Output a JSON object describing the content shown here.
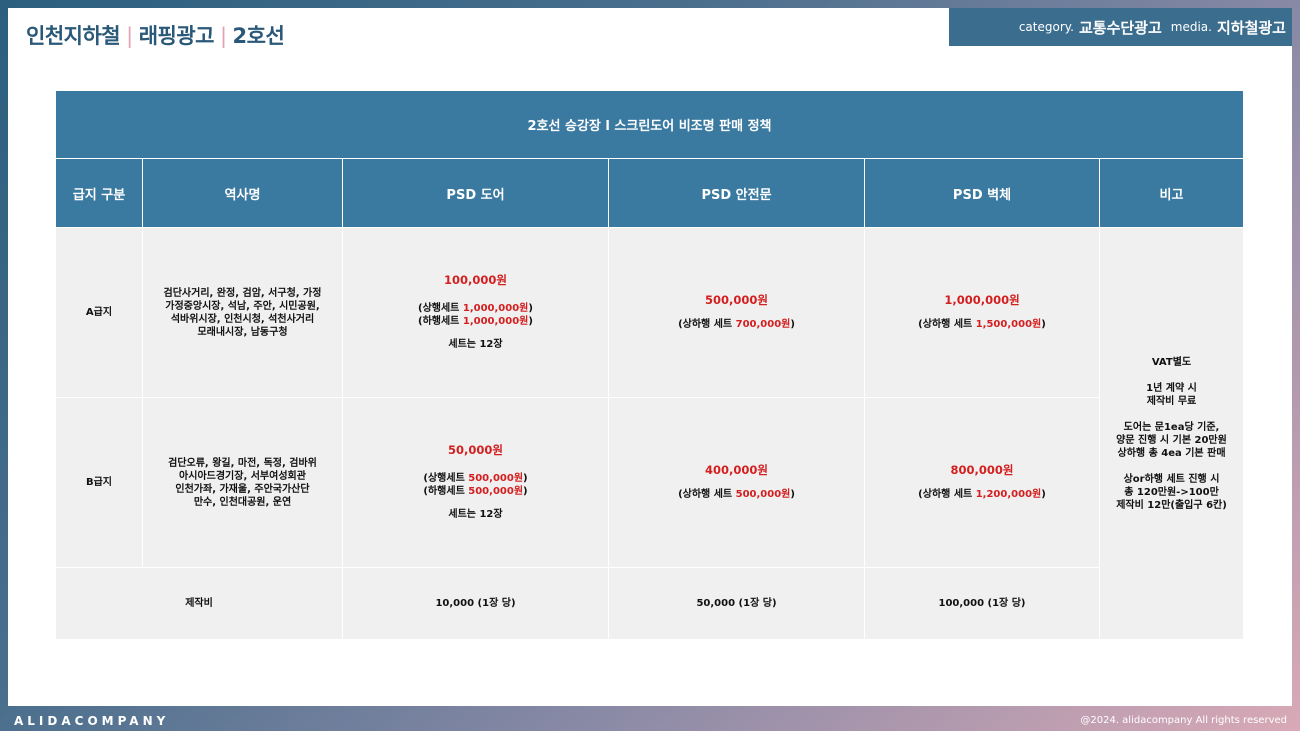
{
  "header": {
    "title_parts": [
      "인천지하철",
      "래핑광고",
      "2호선"
    ],
    "separator": "|",
    "category_label": "category.",
    "category_value": "교통수단광고",
    "media_label": "media.",
    "media_value": "지하철광고"
  },
  "table": {
    "title": "2호선 승강장 l 스크린도어 비조명 판매 정책",
    "columns": [
      "급지 구분",
      "역사명",
      "PSD 도어",
      "PSD 안전문",
      "PSD 벽체",
      "비고"
    ],
    "rows": [
      {
        "grade": "A급지",
        "stations": [
          "검단사거리, 완정, 검암, 서구청, 가정",
          "가정중앙시장, 석남, 주안, 시민공원,",
          "석바위시장, 인천시청, 석천사거리",
          "모래내시장, 남동구청"
        ],
        "door_price": "100,000원",
        "door_set1_label": "(상행세트 ",
        "door_set1_value": "1,000,000원",
        "door_set1_close": ")",
        "door_set2_label": "(하행세트 ",
        "door_set2_value": "1,000,000원",
        "door_set2_close": ")",
        "door_set_count": "세트는 12장",
        "safety_price": "500,000원",
        "safety_set_label": "(상하행 세트 ",
        "safety_set_value": "700,000원",
        "safety_set_close": ")",
        "wall_price": "1,000,000원",
        "wall_set_label": "(상하행 세트 ",
        "wall_set_value": "1,500,000원",
        "wall_set_close": ")"
      },
      {
        "grade": "B급지",
        "stations": [
          "검단오류, 왕길, 마전, 독정, 검바위",
          "아시아드경기장, 서부여성회관",
          "인천가좌, 가재울, 주안국가산단",
          "만수, 인천대공원, 운연"
        ],
        "door_price": "50,000원",
        "door_set1_label": "(상행세트 ",
        "door_set1_value": "500,000원",
        "door_set1_close": ")",
        "door_set2_label": "(하행세트 ",
        "door_set2_value": "500,000원",
        "door_set2_close": ")",
        "door_set_count": "세트는 12장",
        "safety_price": "400,000원",
        "safety_set_label": "(상하행 세트 ",
        "safety_set_value": "500,000원",
        "safety_set_close": ")",
        "wall_price": "800,000원",
        "wall_set_label": "(상하행 세트 ",
        "wall_set_value": "1,200,000원",
        "wall_set_close": ")"
      }
    ],
    "production": {
      "label": "제작비",
      "door": "10,000 (1장 당)",
      "safety": "50,000 (1장 당)",
      "wall": "100,000 (1장 당)"
    },
    "remarks": [
      [
        "VAT별도"
      ],
      [
        "1년 계약 시",
        "제작비 무료"
      ],
      [
        "도어는 문1ea당 기준,",
        "양문 진행 시 기본 20만원",
        "상하행 총 4ea 기본 판매"
      ],
      [
        "상or하행 세트 진행 시",
        "총 120만원->100만",
        "제작비 12만(출입구 6칸)"
      ]
    ]
  },
  "footer": {
    "brand": "ALIDACOMPANY",
    "copyright": "@2024. alidacompany All rights reserved"
  }
}
